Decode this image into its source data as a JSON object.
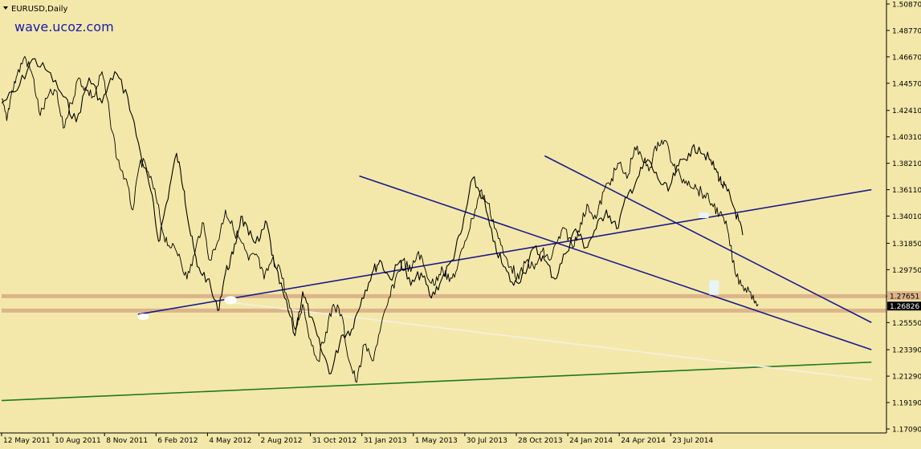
{
  "window": {
    "title": "EURUSD,Daily",
    "watermark": "wave.ucoz.com"
  },
  "colors": {
    "background": "#F3E8A9",
    "candles": "#000000",
    "trend_lines": "#1A1A8C",
    "support_line": "#1E7A1E",
    "faint_line": "#F5EFE0",
    "resistance_band": "#DDB48A",
    "watermark": "#1A1AB0"
  },
  "chart_data": {
    "type": "line",
    "symbol": "EURUSD",
    "timeframe": "Daily",
    "ylim": [
      1.1709,
      1.5087
    ],
    "y_ticks": [
      "1.50870",
      "1.48770",
      "1.46670",
      "1.44570",
      "1.42410",
      "1.40310",
      "1.38210",
      "1.36110",
      "1.34010",
      "1.31850",
      "1.29750",
      "1.27651",
      "1.25550",
      "1.23390",
      "1.21290",
      "1.19190",
      "1.17090"
    ],
    "x_ticks": [
      "12 May 2011",
      "10 Aug 2011",
      "8 Nov 2011",
      "6 Feb 2012",
      "4 May 2012",
      "2 Aug 2012",
      "31 Oct 2012",
      "31 Jan 2013",
      "1 May 2013",
      "30 Jul 2013",
      "28 Oct 2013",
      "24 Jan 2014",
      "24 Apr 2014",
      "23 Jul 2014"
    ],
    "current_price": "1.26826",
    "level_labels": [
      "1.27651",
      "1.26826"
    ],
    "series": [
      {
        "x": [
          0,
          0.3,
          0.6,
          0.9,
          1.2,
          1.45,
          1.7,
          1.95,
          2.2,
          2.45,
          2.7,
          2.9,
          3.05,
          3.2,
          3.4,
          3.55,
          3.65,
          3.8,
          4.0,
          4.2,
          4.35,
          4.5,
          4.65,
          4.8,
          5.0,
          5.15,
          5.3,
          5.5,
          5.7,
          5.85,
          6.0,
          6.2,
          6.4,
          6.6,
          6.8,
          7.0,
          7.2,
          7.35,
          7.55,
          7.75,
          7.95,
          8.15,
          8.35,
          8.55,
          8.75,
          8.95,
          9.15,
          9.35,
          9.55,
          9.75,
          9.95,
          10.15,
          10.35,
          10.55,
          10.75,
          10.95,
          11.15,
          11.35,
          11.55,
          11.75,
          11.95,
          12.15,
          12.35,
          12.55,
          12.75,
          12.95,
          13.15,
          13.35,
          13.55,
          13.75,
          13.9,
          14.0,
          14.1,
          14.25,
          14.4
        ],
        "y": [
          1.43,
          1.44,
          1.465,
          1.455,
          1.435,
          1.415,
          1.45,
          1.43,
          1.455,
          1.435,
          1.39,
          1.36,
          1.32,
          1.35,
          1.39,
          1.36,
          1.33,
          1.3,
          1.29,
          1.265,
          1.295,
          1.31,
          1.34,
          1.325,
          1.32,
          1.335,
          1.3,
          1.275,
          1.245,
          1.28,
          1.26,
          1.235,
          1.215,
          1.245,
          1.25,
          1.275,
          1.295,
          1.305,
          1.29,
          1.305,
          1.285,
          1.295,
          1.275,
          1.29,
          1.305,
          1.33,
          1.37,
          1.355,
          1.32,
          1.3,
          1.285,
          1.295,
          1.315,
          1.305,
          1.29,
          1.31,
          1.33,
          1.315,
          1.33,
          1.345,
          1.33,
          1.355,
          1.37,
          1.385,
          1.37,
          1.36,
          1.38,
          1.39,
          1.395,
          1.385,
          1.375,
          1.365,
          1.36,
          1.345,
          1.325
        ]
      },
      {
        "x": [
          0,
          0.1,
          0.2,
          0.3,
          0.45,
          0.6,
          0.75,
          0.9,
          1.05,
          1.2,
          1.35,
          1.5,
          1.65,
          1.8,
          1.95,
          2.1,
          2.25,
          2.4,
          2.55,
          2.7,
          2.85,
          3.0,
          3.15,
          3.3,
          3.45,
          3.6,
          3.75,
          3.9,
          4.05,
          4.2,
          4.35,
          4.5,
          4.65,
          4.8,
          4.95,
          5.1,
          5.25,
          5.4,
          5.55,
          5.7,
          5.85,
          6.0,
          6.15,
          6.3,
          6.45,
          6.6,
          6.75,
          6.9,
          7.05,
          7.2,
          7.35,
          7.5,
          7.65,
          7.8,
          7.95,
          8.1,
          8.25,
          8.4,
          8.55,
          8.7,
          8.85,
          9.0,
          9.15,
          9.3,
          9.45,
          9.6,
          9.75,
          9.9,
          10.05,
          10.2,
          10.35,
          10.5,
          10.65,
          10.8,
          10.95,
          11.1,
          11.25,
          11.4,
          11.55,
          11.7,
          11.85,
          12.0,
          12.15,
          12.3,
          12.45,
          12.6,
          12.75,
          12.9,
          13.05,
          13.2,
          13.35,
          13.5,
          13.65,
          13.8,
          13.95,
          14.1,
          14.25,
          14.4,
          14.55,
          14.7
        ],
        "y": [
          1.433,
          1.416,
          1.44,
          1.452,
          1.467,
          1.452,
          1.42,
          1.435,
          1.44,
          1.41,
          1.43,
          1.45,
          1.44,
          1.435,
          1.455,
          1.42,
          1.385,
          1.37,
          1.345,
          1.385,
          1.375,
          1.355,
          1.325,
          1.315,
          1.31,
          1.29,
          1.31,
          1.335,
          1.305,
          1.32,
          1.345,
          1.33,
          1.32,
          1.305,
          1.31,
          1.29,
          1.305,
          1.3,
          1.275,
          1.25,
          1.27,
          1.242,
          1.225,
          1.248,
          1.27,
          1.262,
          1.225,
          1.208,
          1.238,
          1.225,
          1.248,
          1.27,
          1.29,
          1.305,
          1.296,
          1.312,
          1.295,
          1.285,
          1.3,
          1.288,
          1.298,
          1.32,
          1.338,
          1.36,
          1.35,
          1.33,
          1.31,
          1.3,
          1.29,
          1.305,
          1.298,
          1.312,
          1.305,
          1.32,
          1.33,
          1.315,
          1.335,
          1.348,
          1.338,
          1.36,
          1.37,
          1.382,
          1.37,
          1.395,
          1.385,
          1.379,
          1.399,
          1.4,
          1.38,
          1.37,
          1.368,
          1.362,
          1.357,
          1.35,
          1.342,
          1.33,
          1.295,
          1.285,
          1.28,
          1.27
        ]
      }
    ],
    "trend_lines": [
      {
        "from": [
          2.65,
          1.262
        ],
        "to": [
          16.9,
          1.3611
        ],
        "color": "trend_lines"
      },
      {
        "from": [
          6.95,
          1.372
        ],
        "to": [
          16.9,
          1.2339
        ],
        "color": "trend_lines"
      },
      {
        "from": [
          10.55,
          1.388
        ],
        "to": [
          16.9,
          1.2555
        ],
        "color": "trend_lines"
      },
      {
        "from": [
          0,
          1.1935
        ],
        "to": [
          16.9,
          1.224
        ],
        "color": "support_line"
      },
      {
        "from": [
          4.35,
          1.272
        ],
        "to": [
          16.9,
          1.21
        ],
        "color": "faint_line"
      }
    ],
    "horizontal_levels": [
      1.2765,
      1.265
    ],
    "grid": false,
    "legend": "none"
  }
}
